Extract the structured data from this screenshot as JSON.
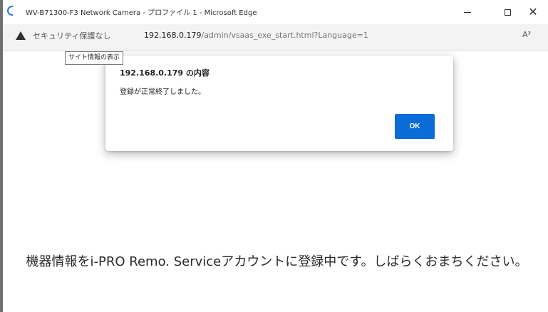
{
  "window": {
    "title": "WV-B71300-F3 Network Camera - プロファイル 1 - Microsoft Edge",
    "controls": {
      "minimize_icon": "minimize-icon",
      "maximize_icon": "maximize-icon",
      "close_glyph": "✕"
    }
  },
  "address_bar": {
    "security_label": "セキュリティ保護なし",
    "url_host": "192.168.0.179",
    "url_path": "/admin/vsaas_exe_start.html?Language=1",
    "read_aloud": "A³"
  },
  "tooltip": {
    "text": "サイト情報の表示"
  },
  "dialog": {
    "title": "192.168.0.179 の内容",
    "message": "登録が正常終了しました。",
    "ok_label": "OK",
    "ok_color": "#0a6cd6"
  },
  "page": {
    "message": "機器情報をi-PRO Remo. Serviceアカウントに登録中です。しばらくおまちください。"
  }
}
